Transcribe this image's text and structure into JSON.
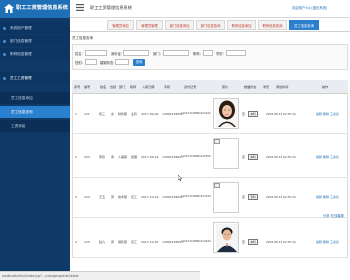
{
  "app": {
    "system_name": "职工工资管理信息系统",
    "header_title": "职工工资管理信息系统",
    "user_info": "欢迎用户:fuj  [退出系统]"
  },
  "sidebar": {
    "items": [
      {
        "label": "系统用户管理"
      },
      {
        "label": "部门信息管理"
      },
      {
        "label": "职称信息管理"
      },
      {
        "label": "员工工资管理"
      },
      {
        "label": "员工信息添加"
      },
      {
        "label": "员工信息查询"
      },
      {
        "label": "工资添加"
      }
    ]
  },
  "tabs": [
    {
      "label": "管理员添加"
    },
    {
      "label": "管理员管理"
    },
    {
      "label": "部门信息添加"
    },
    {
      "label": "部门信息查询"
    },
    {
      "label": "职称信息添加"
    },
    {
      "label": "职称信息查询"
    },
    {
      "label": "员工信息查询"
    }
  ],
  "breadcrumb": "员工信息查询",
  "filters": {
    "row1": [
      {
        "label": "姓名:"
      },
      {
        "label": "身份证:"
      },
      {
        "label": "部门:"
      },
      {
        "label": "职称:"
      },
      {
        "label": "学历:"
      }
    ],
    "row2": [
      {
        "label": "性别:"
      },
      {
        "label": "婚姻状态:"
      }
    ],
    "search_button": "查询"
  },
  "table": {
    "columns": [
      "序号",
      "编号",
      "姓名",
      "性别",
      "部门",
      "职称",
      "入职日期",
      "手机",
      "身份证号",
      "照片",
      "婚姻状态",
      "学历",
      "添加时间",
      "操作"
    ],
    "rows": [
      {
        "index": "1",
        "id": "121",
        "name": "张三",
        "gender": "女",
        "dept": "财务部",
        "title": "主管",
        "date": "2017-09-09",
        "phone": "13800138000",
        "idcard": "110101198801012222",
        "photo": "woman",
        "marital": "否",
        "edu": "本科",
        "added": "2018-08-14 02:35:24",
        "ops": "编辑 删除 工资表"
      },
      {
        "index": "2",
        "id": "333",
        "name": "李四",
        "gender": "男",
        "dept": "人事部",
        "title": "经理",
        "date": "2017-09-19",
        "phone": "13800138001",
        "idcard": "110101198801015555",
        "photo": "broken",
        "marital": "否",
        "edu": "本科",
        "added": "2018-08-14 02:35:24",
        "ops": "编辑 删除 工资表"
      },
      {
        "index": "3",
        "id": "124",
        "name": "王五",
        "gender": "男",
        "dept": "技术部",
        "title": "员工",
        "date": "2017-10-19",
        "phone": "13800138002",
        "idcard": "110101198801013333",
        "photo": "broken",
        "marital": "否",
        "edu": "专科",
        "added": "2018-08-14 02:35:24",
        "ops": "编辑 删除 工资表"
      },
      {
        "index": "4",
        "id": "125",
        "name": "赵六",
        "gender": "男",
        "dept": "销售部",
        "title": "员工",
        "date": "2017-10-20",
        "phone": "13800138003",
        "idcard": "110101198801014444",
        "photo": "man",
        "marital": "否",
        "edu": "本科",
        "added": "2018-08-14 02:35:24",
        "ops": "编辑 删除 工资表"
      }
    ]
  },
  "status_url": "localhost/shixi/index.jsp?...yuangongxinxi&kbdx",
  "float_widget": "分享 在线客服",
  "colors": {
    "brand": "#1e6fb5",
    "sidebar": "#0f3a67",
    "active": "#2b7fcf",
    "tab_text": "#c0392b"
  }
}
